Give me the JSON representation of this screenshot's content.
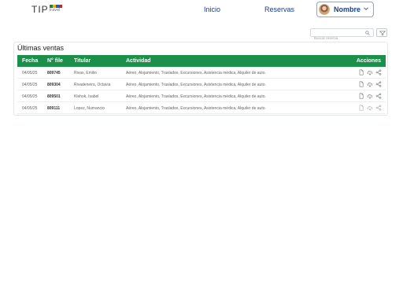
{
  "logo": {
    "text": "TIP",
    "sub": "travel",
    "colors": [
      "#2e7d32",
      "#f9a825",
      "#1565c0",
      "#c62828"
    ]
  },
  "nav": {
    "inicio": "Inicio",
    "reservas": "Reservas"
  },
  "user": {
    "name": "Nombre"
  },
  "search": {
    "placeholder": "Buscar reserva"
  },
  "panel": {
    "title": "Últimas ventas"
  },
  "table": {
    "headers": {
      "fecha": "Fecha",
      "file": "N° file",
      "titular": "Titular",
      "actividad": "Actividad",
      "acciones": "Acciones"
    },
    "rows": [
      {
        "fecha": "04/05/25",
        "file": "809745",
        "titular": "Rivas, Emilio",
        "actividad": "Aéreo, Alojamiento, Traslados, Excursiones, Asistencia médica, Alquiler de auto."
      },
      {
        "fecha": "04/05/25",
        "file": "809304",
        "titular": "Rivadeneira, Octavia",
        "actividad": "Aéreo, Alojamiento, Traslados, Excursiones, Asistencia médica, Alquiler de auto."
      },
      {
        "fecha": "04/05/25",
        "file": "809501",
        "titular": "Klehok, Isabel",
        "actividad": "Aéreo, Alojamiento, Traslados, Excursiones, Asistencia médica, Alquiler de auto."
      },
      {
        "fecha": "04/05/25",
        "file": "809111",
        "titular": "Lopez, Numancio",
        "actividad": "Aéreo, Alojamiento, Traslados, Excursiones, Asistencia médica, Alquiler de auto."
      }
    ]
  },
  "icons": {
    "row_actions": [
      "document-icon",
      "cloud-download-icon",
      "share-icon"
    ],
    "search": "search-icon",
    "filter": "filter-icon",
    "dropdown": "chevron-down-icon"
  },
  "colors": {
    "accent": "#1c8f4b",
    "nav_text": "#1a3e8f"
  }
}
